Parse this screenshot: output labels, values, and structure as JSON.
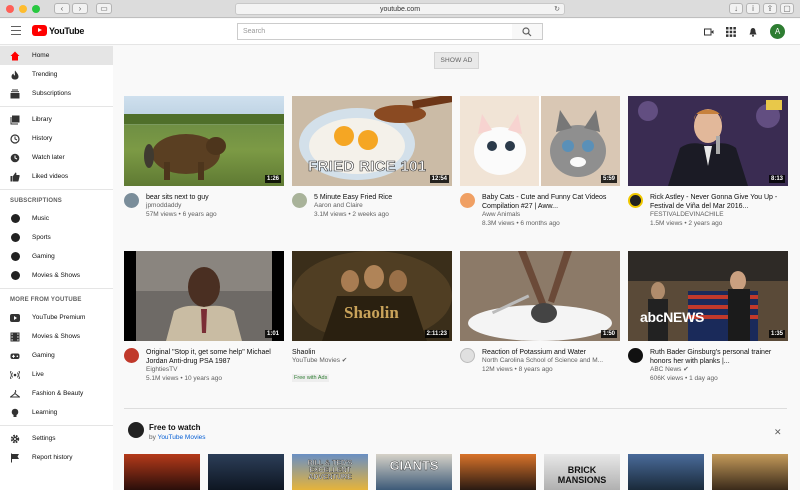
{
  "browser": {
    "url": "youtube.com"
  },
  "masthead": {
    "logo_text": "YouTube",
    "search_placeholder": "Search",
    "avatar_letter": "A"
  },
  "sidebar": {
    "main": [
      {
        "label": "Home",
        "icon": "home-icon"
      },
      {
        "label": "Trending",
        "icon": "flame-icon"
      },
      {
        "label": "Subscriptions",
        "icon": "subscriptions-icon"
      }
    ],
    "library": [
      {
        "label": "Library",
        "icon": "library-icon"
      },
      {
        "label": "History",
        "icon": "history-icon"
      },
      {
        "label": "Watch later",
        "icon": "clock-icon"
      },
      {
        "label": "Liked videos",
        "icon": "thumbs-up-icon"
      }
    ],
    "subscriptions_heading": "SUBSCRIPTIONS",
    "subscriptions": [
      {
        "label": "Music",
        "icon": "music-channel-icon"
      },
      {
        "label": "Sports",
        "icon": "sports-channel-icon"
      },
      {
        "label": "Gaming",
        "icon": "gaming-channel-icon"
      },
      {
        "label": "Movies & Shows",
        "icon": "movies-channel-icon"
      }
    ],
    "more_heading": "MORE FROM YOUTUBE",
    "more": [
      {
        "label": "YouTube Premium",
        "icon": "youtube-icon"
      },
      {
        "label": "Movies & Shows",
        "icon": "film-icon"
      },
      {
        "label": "Gaming",
        "icon": "gamepad-icon"
      },
      {
        "label": "Live",
        "icon": "live-icon"
      },
      {
        "label": "Fashion & Beauty",
        "icon": "hanger-icon"
      },
      {
        "label": "Learning",
        "icon": "lightbulb-icon"
      }
    ],
    "bottom": [
      {
        "label": "Settings",
        "icon": "gear-icon"
      },
      {
        "label": "Report history",
        "icon": "flag-icon"
      }
    ]
  },
  "show_ad_label": "SHOW AD",
  "videos": [
    {
      "title": "bear sits next to guy",
      "channel": "jpmoddaddy",
      "stats": "57M views • 6 years ago",
      "duration": "1:26"
    },
    {
      "title": "5 Minute Easy Fried Rice",
      "channel": "Aaron and Claire",
      "stats": "3.1M views • 2 weeks ago",
      "duration": "12:54",
      "thumb_text": "FRIED RICE 101"
    },
    {
      "title": "Baby Cats - Cute and Funny Cat Videos Compilation #27 | Aww...",
      "channel": "Aww Animals",
      "stats": "8.3M views • 6 months ago",
      "duration": "5:59"
    },
    {
      "title": "Rick Astley - Never Gonna Give You Up - Festival de Viña del Mar 2016...",
      "channel": "FESTIVALDEVINACHILE",
      "stats": "1.5M views • 2 years ago",
      "duration": "8:13"
    },
    {
      "title": "Original \"Stop it, get some help\" Michael Jordan Anti-drug PSA 1987",
      "channel": "EightiesTV",
      "stats": "5.1M views • 10 years ago",
      "duration": "1:01"
    },
    {
      "title": "Shaolin",
      "channel": "YouTube Movies",
      "stats": "",
      "badge": "Free with Ads",
      "duration": "2:11:23",
      "thumb_text": "Shaolin"
    },
    {
      "title": "Reaction of Potassium and Water",
      "channel": "North Carolina School of Science and M...",
      "stats": "12M views • 8 years ago",
      "duration": "1:50"
    },
    {
      "title": "Ruth Bader Ginsburg's personal trainer honors her with planks |...",
      "channel": "ABC News",
      "stats": "606K views • 1 day ago",
      "duration": "1:35",
      "thumb_text": "abcNEWS"
    }
  ],
  "free_to_watch": {
    "title": "Free to watch",
    "by": "by",
    "channel": "YouTube Movies"
  },
  "posters": [
    "",
    "",
    "BILL & TED'S EXCELLENT ADVENTURE",
    "GIANTS",
    "",
    "BRICK MANSIONS",
    "",
    ""
  ]
}
